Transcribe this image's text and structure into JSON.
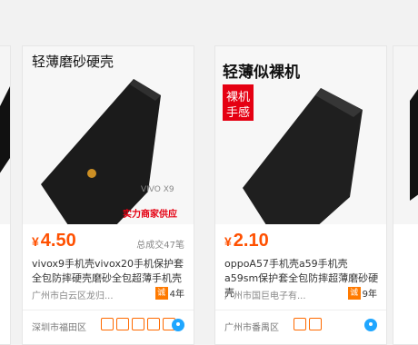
{
  "products": [
    {
      "banner": "轻薄磨砂硬壳",
      "brand_watermark": "VIVO X9",
      "caption": "实力商家供应",
      "price": "4.50",
      "currency_symbol": "¥",
      "sold": "总成交47笔",
      "title": "vivox9手机壳vivox20手机保护套全包防摔硬壳磨砂全包超薄手机壳",
      "shop": "广州市白云区龙归...",
      "years": "4年",
      "location": "深圳市福田区",
      "icons": [
        "shop-badge-icon",
        "shop-badge-icon",
        "shield-icon",
        "shield-icon",
        "shield-icon"
      ]
    },
    {
      "banner": "轻薄似裸机",
      "tag_line1": "裸机",
      "tag_line2": "手感",
      "price": "2.10",
      "currency_symbol": "¥",
      "title": "oppoA57手机壳a59手机壳a59sm保护套全包防摔超薄磨砂硬壳",
      "shop": "广州市国巨电子有...",
      "years": "9年",
      "location": "广州市番禺区",
      "icons": [
        "shield-icon",
        "shield-icon"
      ]
    }
  ],
  "year_tag": "诚",
  "colors": {
    "price": "#ff5000",
    "tag_bg": "#e50012"
  }
}
